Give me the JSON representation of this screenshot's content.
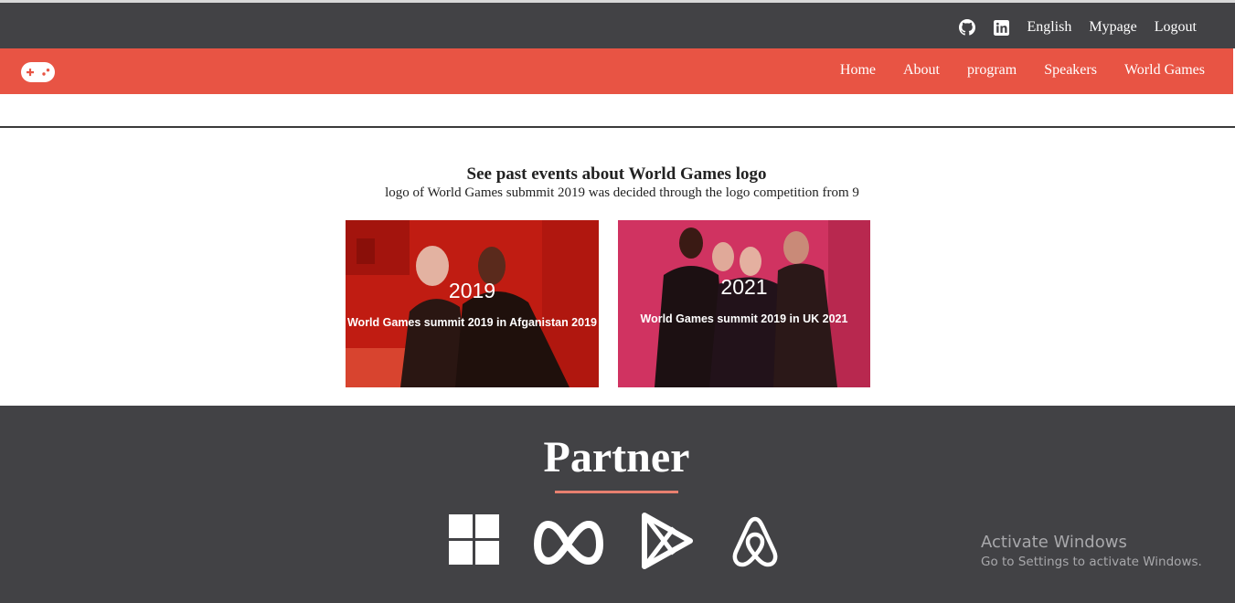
{
  "topbar": {
    "icons": [
      "github-icon",
      "linkedin-icon"
    ],
    "links": [
      "English",
      "Mypage",
      "Logout"
    ]
  },
  "navbar": {
    "logo_icon": "gamepad-icon",
    "items": [
      "Home",
      "About",
      "program",
      "Speakers",
      "World Games"
    ]
  },
  "past_events": {
    "title": "See past events about World Games logo",
    "subtitle": "logo of World Games submmit 2019 was decided through the logo competition from 9",
    "cards": [
      {
        "year": "2019",
        "caption": "World Games summit 2019 in Afganistan 2019"
      },
      {
        "year": "2021",
        "caption": "World Games summit 2019 in UK 2021"
      }
    ]
  },
  "partner": {
    "title": "Partner",
    "logos": [
      "windows-icon",
      "meta-icon",
      "google-play-icon",
      "airbnb-icon"
    ]
  },
  "watermark": {
    "title": "Activate Windows",
    "subtitle": "Go to Settings to activate Windows."
  },
  "colors": {
    "topbar": "#424245",
    "navbar": "#e85444",
    "footer": "#424245",
    "accent_underline": "#e8806f"
  }
}
